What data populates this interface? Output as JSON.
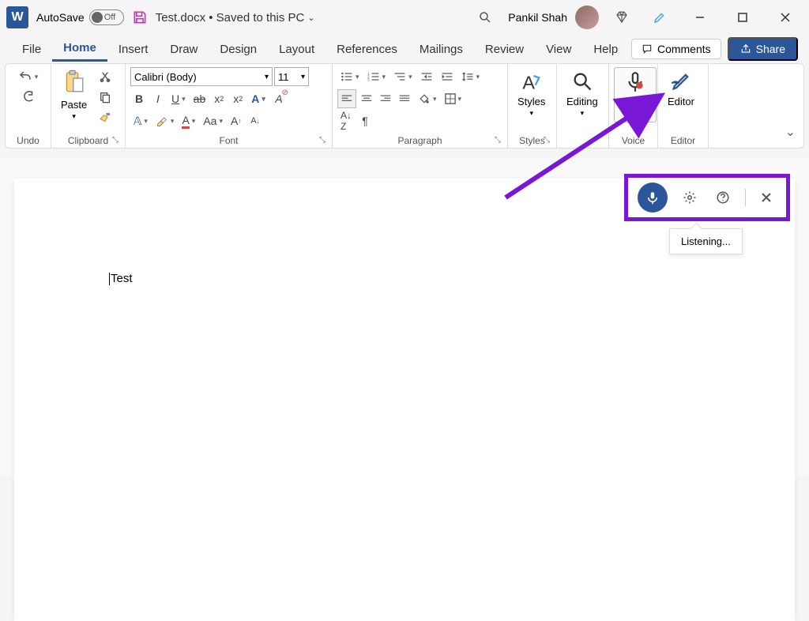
{
  "titlebar": {
    "autosave_label": "AutoSave",
    "autosave_state": "Off",
    "doc_title": "Test.docx • Saved to this PC",
    "user_name": "Pankil Shah"
  },
  "menu": {
    "tabs": [
      "File",
      "Home",
      "Insert",
      "Draw",
      "Design",
      "Layout",
      "References",
      "Mailings",
      "Review",
      "View",
      "Help"
    ],
    "active": "Home",
    "comments": "Comments",
    "share": "Share"
  },
  "ribbon": {
    "undo_label": "Undo",
    "clipboard": {
      "paste": "Paste",
      "label": "Clipboard"
    },
    "font": {
      "name": "Calibri (Body)",
      "size": "11",
      "label": "Font"
    },
    "paragraph_label": "Paragraph",
    "styles": {
      "btn": "Styles",
      "label": "Styles"
    },
    "editing": {
      "btn": "Editing"
    },
    "voice": {
      "btn": "Dictate",
      "label": "Voice"
    },
    "editor": {
      "btn": "Editor",
      "label": "Editor"
    }
  },
  "document": {
    "text": "Test"
  },
  "dictation": {
    "status": "Listening..."
  }
}
